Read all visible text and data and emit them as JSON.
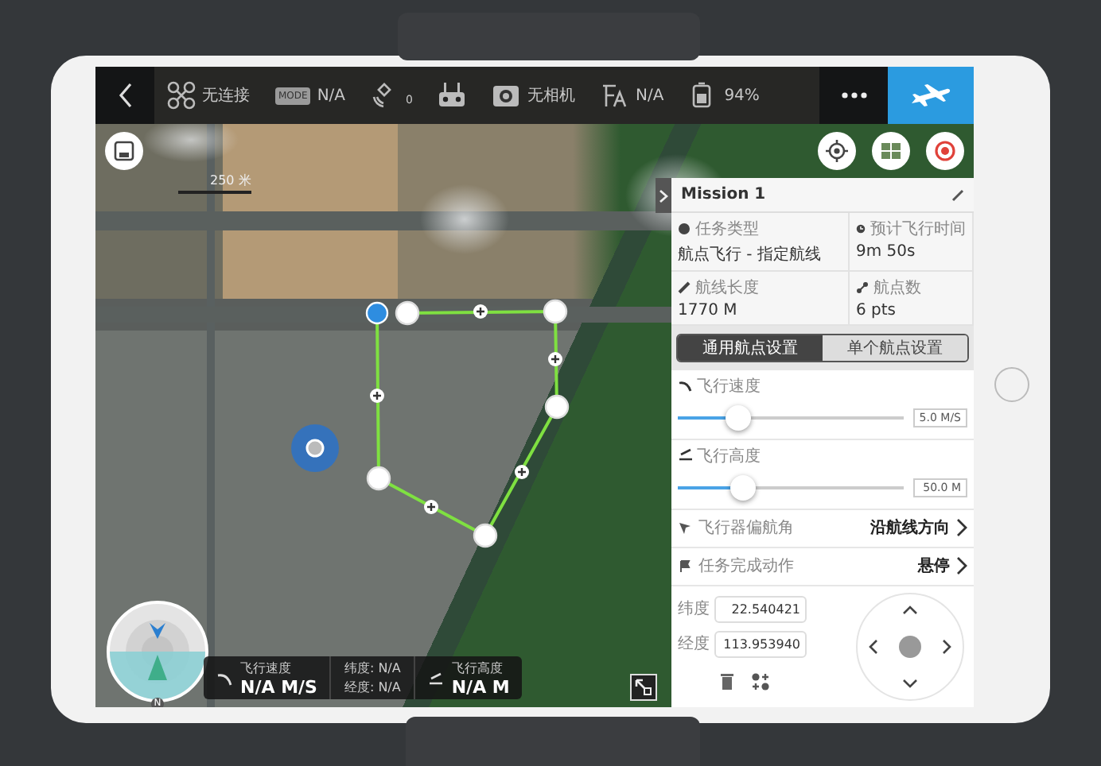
{
  "top_bar": {
    "items": [
      {
        "kind": "drone",
        "text": "无连接"
      },
      {
        "kind": "mode",
        "badge": "MODE",
        "text": "N/A"
      },
      {
        "kind": "satellite",
        "count": "0"
      },
      {
        "kind": "remote"
      },
      {
        "kind": "camera",
        "text": "无相机"
      },
      {
        "kind": "gps",
        "text": "N/A"
      },
      {
        "kind": "battery",
        "text": "94%"
      }
    ]
  },
  "map": {
    "scale": "250 米",
    "waypoints": [
      {
        "selected": true
      },
      {
        "selected": false
      },
      {
        "selected": false
      },
      {
        "selected": false
      },
      {
        "selected": false
      },
      {
        "selected": false
      }
    ]
  },
  "hud": {
    "compass": "N",
    "speed_label": "飞行速度",
    "speed": "N/A M/S",
    "latitude": "纬度: N/A",
    "longitude": "经度: N/A",
    "altitude_label": "飞行高度",
    "altitude": "N/A M"
  },
  "panel": {
    "title": "Mission 1",
    "info": [
      {
        "kind": "type",
        "label": "任务类型",
        "value": "航点飞行 - 指定航线"
      },
      {
        "kind": "time",
        "label": "预计飞行时间",
        "value": "9m 50s"
      },
      {
        "kind": "length",
        "label": "航线长度",
        "value": "1770 M"
      },
      {
        "kind": "points",
        "label": "航点数",
        "value": "6 pts"
      }
    ],
    "tabs": [
      {
        "label": "通用航点设置",
        "selected": true
      },
      {
        "label": "单个航点设置",
        "selected": false
      }
    ],
    "sliders": [
      {
        "kind": "speed",
        "label": "飞行速度",
        "level": 0.27,
        "reading": "5.0 M/S"
      },
      {
        "kind": "altitude",
        "label": "飞行高度",
        "level": 0.29,
        "reading": "50.0 M"
      }
    ],
    "options": [
      {
        "kind": "yaw",
        "label": "飞行器偏航角",
        "value": "沿航线方向"
      },
      {
        "kind": "finish",
        "label": "任务完成动作",
        "value": "悬停"
      }
    ],
    "coords": [
      {
        "label": "纬度",
        "value": "22.540421"
      },
      {
        "label": "经度",
        "value": "113.953940"
      }
    ]
  }
}
